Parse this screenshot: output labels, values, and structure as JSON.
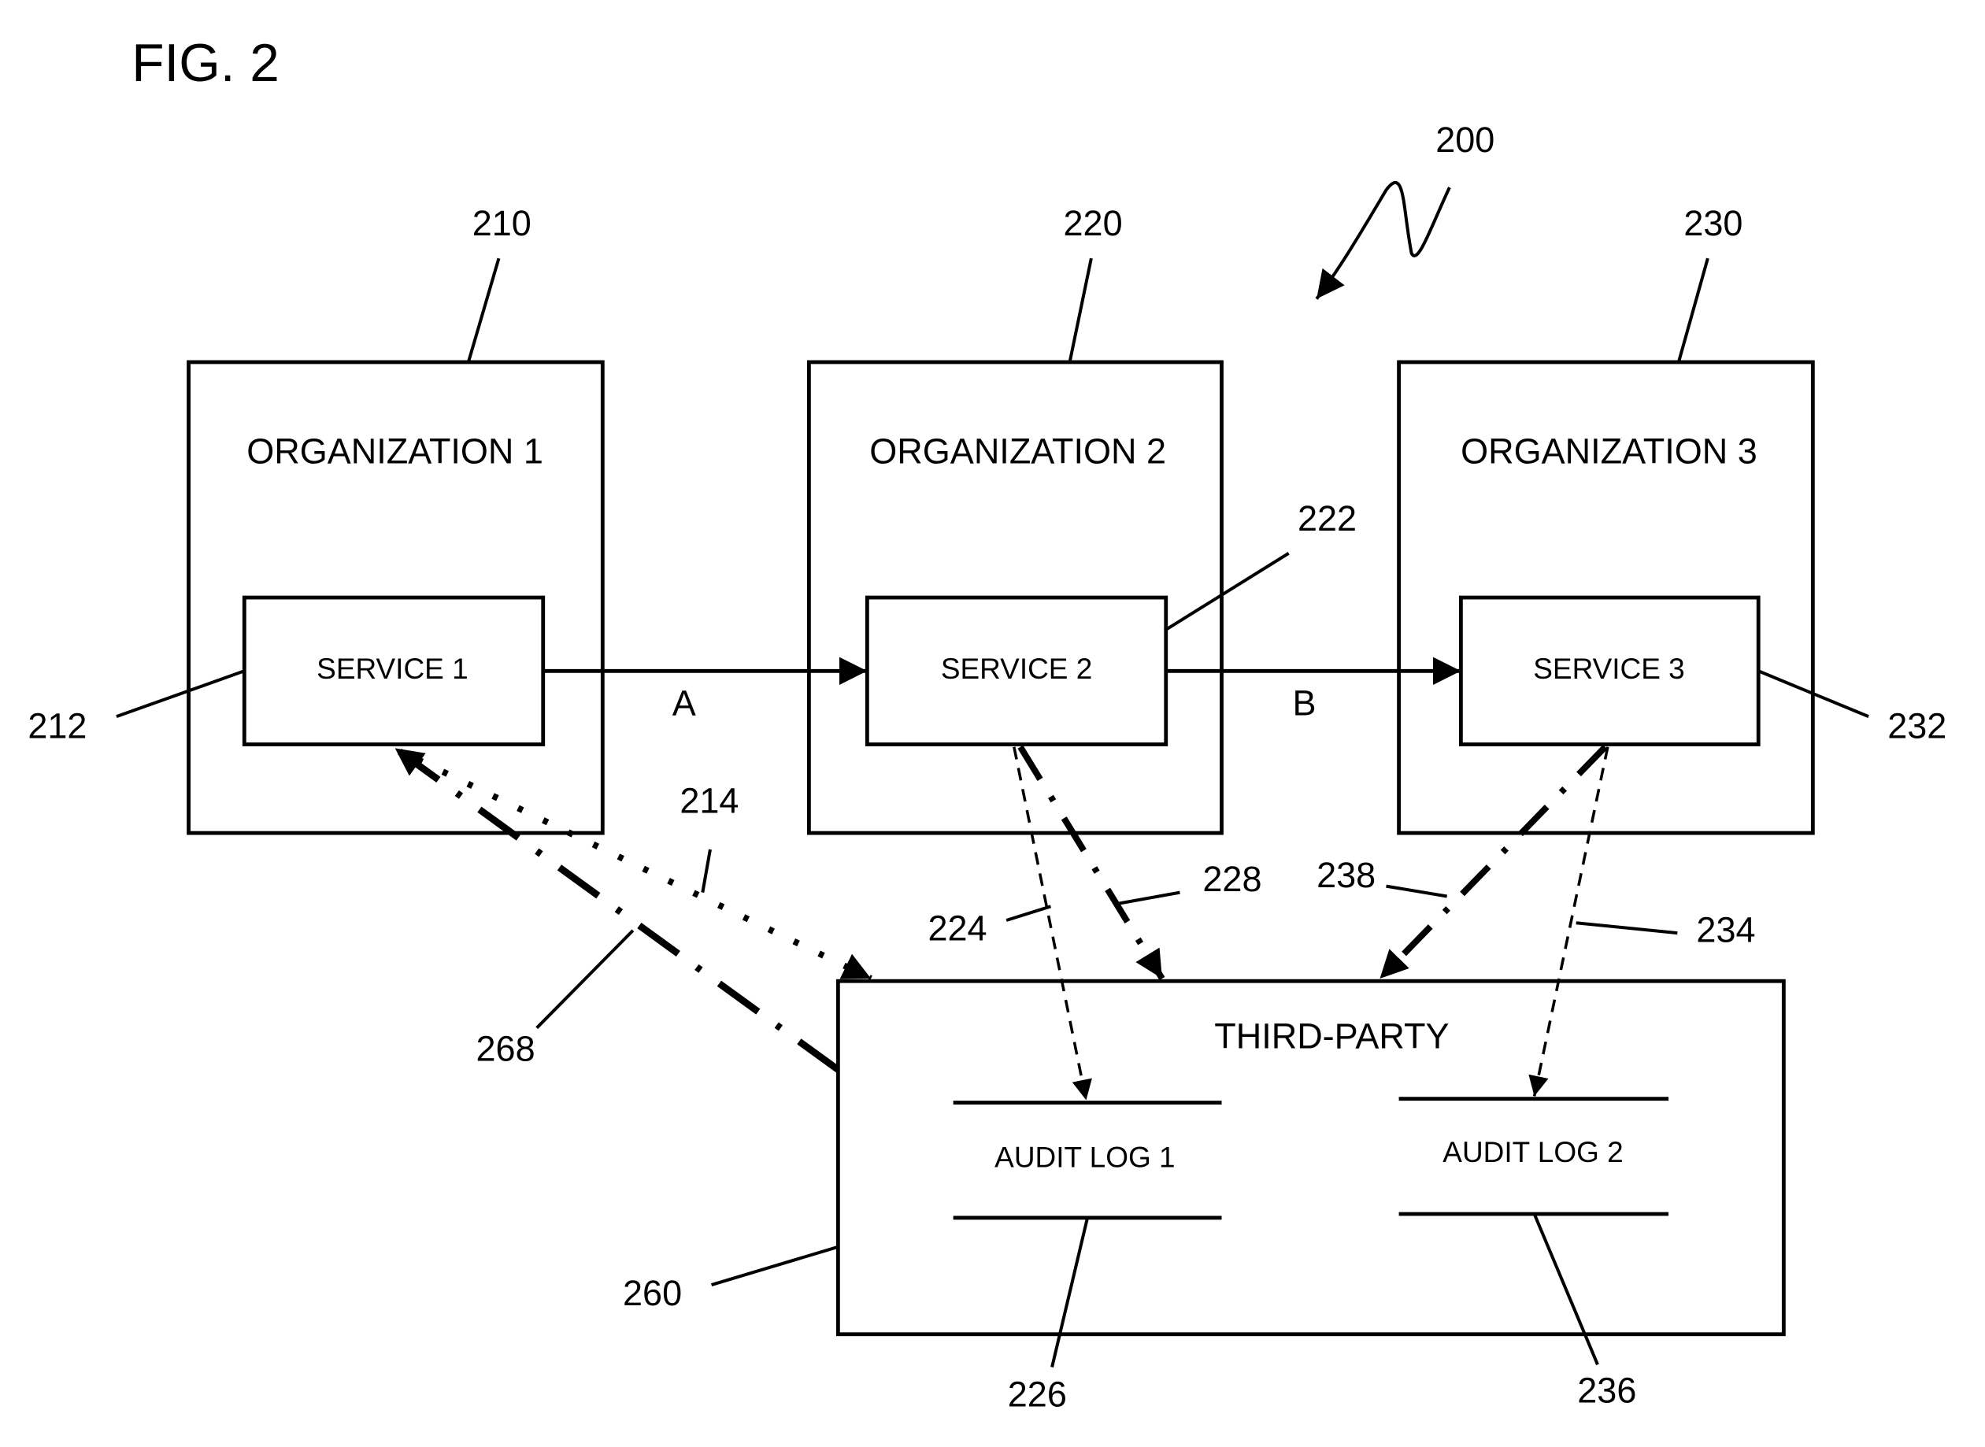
{
  "figure": {
    "title": "FIG. 2",
    "ref": "200"
  },
  "organizations": [
    {
      "label": "ORGANIZATION 1",
      "ref": "210"
    },
    {
      "label": "ORGANIZATION 2",
      "ref": "220"
    },
    {
      "label": "ORGANIZATION 3",
      "ref": "230"
    }
  ],
  "services": [
    {
      "label": "SERVICE 1",
      "ref": "212"
    },
    {
      "label": "SERVICE 2",
      "ref": "222"
    },
    {
      "label": "SERVICE 3",
      "ref": "232"
    }
  ],
  "flows": [
    {
      "label": "A",
      "from": "SERVICE 1",
      "to": "SERVICE 2"
    },
    {
      "label": "B",
      "from": "SERVICE 2",
      "to": "SERVICE 3"
    }
  ],
  "third_party": {
    "label": "THIRD-PARTY",
    "ref": "260",
    "logs": [
      {
        "label": "AUDIT LOG 1",
        "ref": "226"
      },
      {
        "label": "AUDIT LOG 2",
        "ref": "236"
      }
    ]
  },
  "connections": [
    {
      "ref": "214",
      "style": "dotted",
      "from": "SERVICE 1",
      "to": "THIRD-PARTY"
    },
    {
      "ref": "268",
      "style": "dash-dot",
      "from": "THIRD-PARTY",
      "to": "SERVICE 1"
    },
    {
      "ref": "224",
      "style": "dashed",
      "from": "SERVICE 2",
      "to": "AUDIT LOG 1"
    },
    {
      "ref": "228",
      "style": "dash-dot",
      "from": "SERVICE 2",
      "to": "THIRD-PARTY"
    },
    {
      "ref": "234",
      "style": "dashed",
      "from": "SERVICE 3",
      "to": "AUDIT LOG 2"
    },
    {
      "ref": "238",
      "style": "dash-dot",
      "from": "SERVICE 3",
      "to": "THIRD-PARTY"
    }
  ]
}
